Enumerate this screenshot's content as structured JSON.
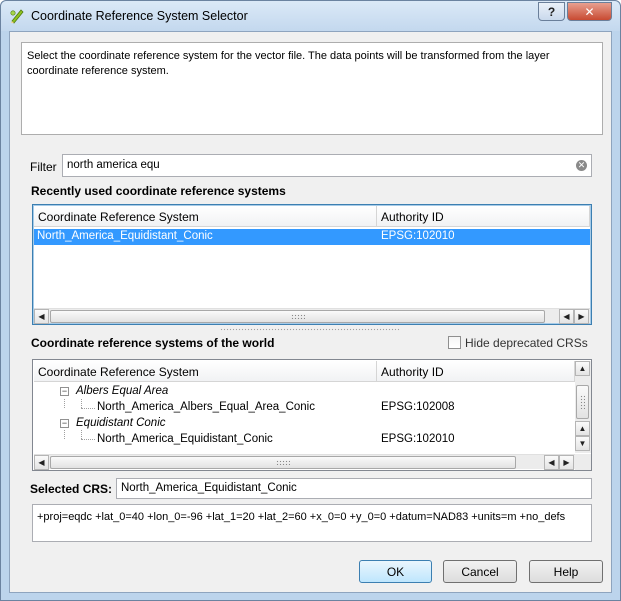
{
  "window": {
    "title": "Coordinate Reference System Selector",
    "help_button": "?",
    "close_button": "✕"
  },
  "description": "Select the coordinate reference system for the vector file. The data points will be transformed from the layer coordinate reference system.",
  "filter": {
    "label": "Filter",
    "value": "north america equ"
  },
  "recent": {
    "heading": "Recently used coordinate reference systems",
    "columns": [
      "Coordinate Reference System",
      "Authority ID"
    ],
    "rows": [
      {
        "name": "North_America_Equidistant_Conic",
        "id": "EPSG:102010",
        "selected": true
      }
    ]
  },
  "world": {
    "heading": "Coordinate reference systems of the world",
    "hide_deprecated_label": "Hide deprecated CRSs",
    "hide_deprecated_checked": false,
    "columns": [
      "Coordinate Reference System",
      "Authority ID"
    ],
    "groups": [
      {
        "name": "Albers Equal Area",
        "items": [
          {
            "name": "North_America_Albers_Equal_Area_Conic",
            "id": "EPSG:102008"
          }
        ]
      },
      {
        "name": "Equidistant Conic",
        "items": [
          {
            "name": "North_America_Equidistant_Conic",
            "id": "EPSG:102010"
          }
        ]
      }
    ]
  },
  "selected_crs": {
    "label": "Selected CRS:",
    "value": "North_America_Equidistant_Conic"
  },
  "proj_string": "+proj=eqdc +lat_0=40 +lon_0=-96 +lat_1=20 +lat_2=60 +x_0=0 +y_0=0 +datum=NAD83 +units=m +no_defs",
  "buttons": {
    "ok": "OK",
    "cancel": "Cancel",
    "help": "Help"
  },
  "colors": {
    "selection": "#3399ff",
    "title_bar": "#c3d8ee",
    "close_button": "#c84a32"
  },
  "icons": {
    "app": "qgis-pencil-icon",
    "clear": "clear-x-icon",
    "tree_expanded": "minus-box-icon"
  }
}
